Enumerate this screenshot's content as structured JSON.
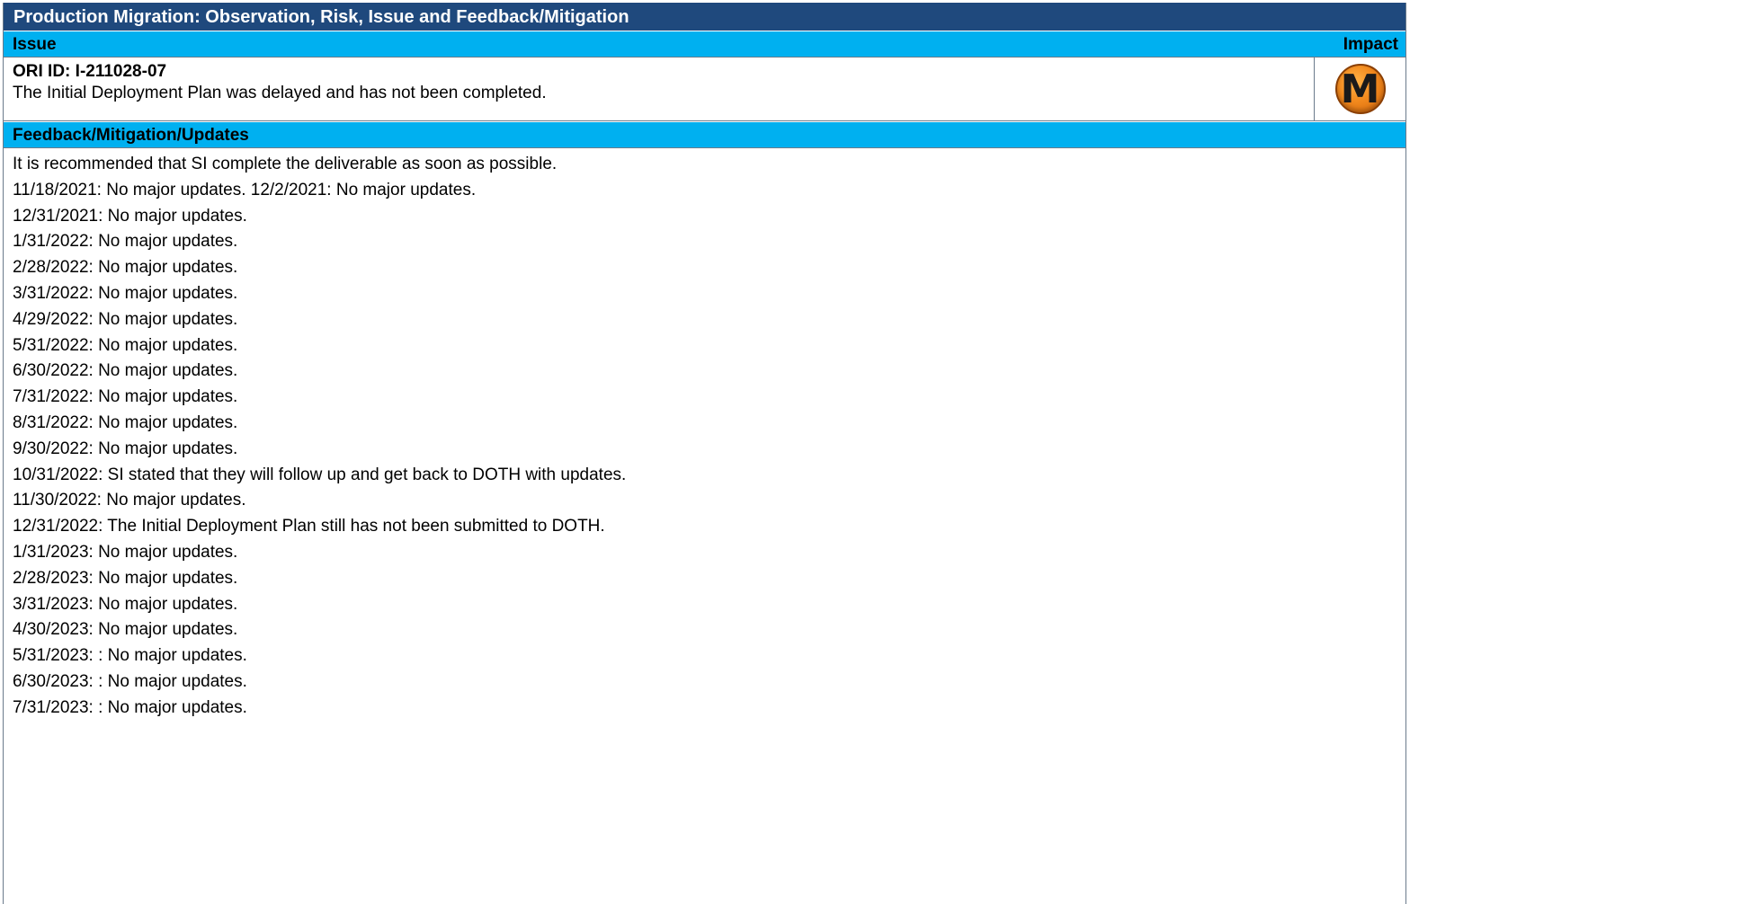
{
  "title": "Production Migration: Observation, Risk, Issue and Feedback/Mitigation",
  "issue_header": {
    "issue_label": "Issue",
    "impact_label": "Impact"
  },
  "issue": {
    "id_line": "ORI ID: I-211028-07",
    "description": "The Initial Deployment Plan was delayed and has not been completed.",
    "impact_level": "M",
    "impact_color": "#f28a1e"
  },
  "updates_header": "Feedback/Mitigation/Updates",
  "updates": [
    "It is recommended that SI complete the deliverable as soon as possible.",
    "11/18/2021: No major updates. 12/2/2021: No major updates.",
    "12/31/2021: No major updates.",
    "1/31/2022: No major updates.",
    "2/28/2022: No major updates.",
    "3/31/2022: No major updates.",
    "4/29/2022: No major updates.",
    "5/31/2022: No major updates.",
    "6/30/2022: No major updates.",
    "7/31/2022: No major updates.",
    "8/31/2022: No major updates.",
    "9/30/2022: No major updates.",
    "10/31/2022: SI stated that they will follow up and get back to DOTH with updates.",
    "11/30/2022: No major updates.",
    "12/31/2022: The Initial Deployment Plan still has not been submitted to DOTH.",
    "1/31/2023: No major updates.",
    "2/28/2023: No major updates.",
    "3/31/2023: No major updates.",
    "4/30/2023: No major updates.",
    "5/31/2023: : No major updates.",
    "6/30/2023: : No major updates.",
    "7/31/2023: : No major updates."
  ],
  "colors": {
    "title_bg": "#1f497d",
    "header_bg": "#00b0f0"
  }
}
